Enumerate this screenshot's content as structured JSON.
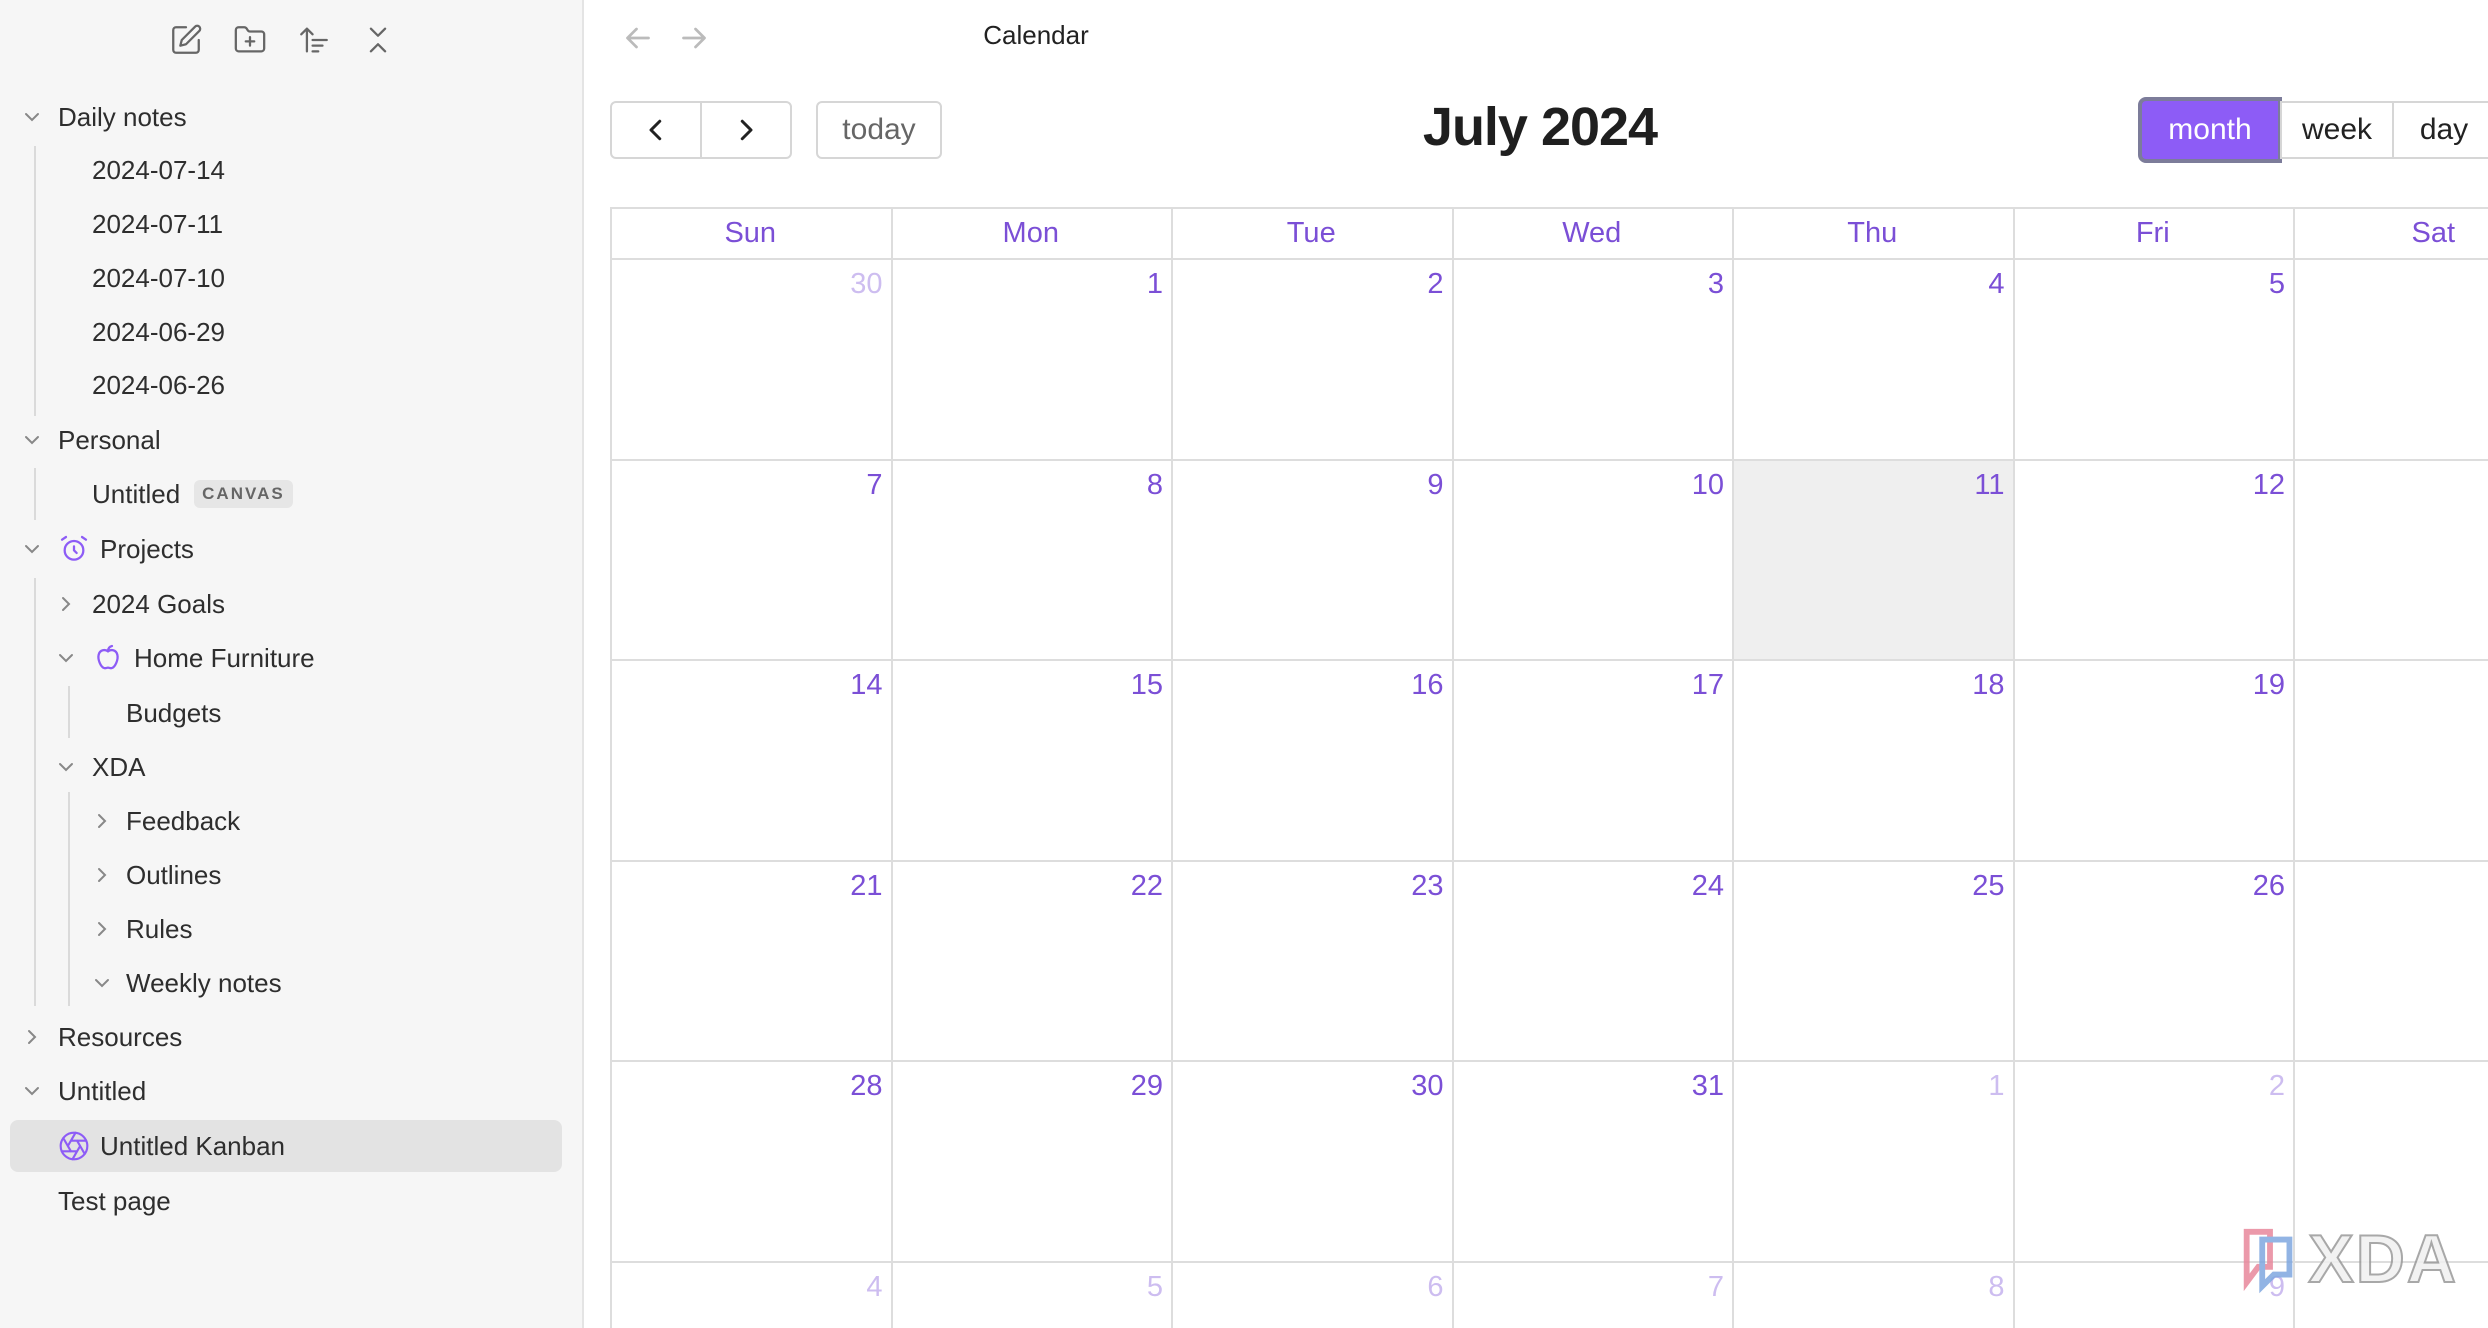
{
  "app": {
    "view_title": "Calendar"
  },
  "sidebar": {
    "items": [
      {
        "label": "Daily notes"
      },
      {
        "label": "2024-07-14"
      },
      {
        "label": "2024-07-11"
      },
      {
        "label": "2024-07-10"
      },
      {
        "label": "2024-06-29"
      },
      {
        "label": "2024-06-26"
      },
      {
        "label": "Personal"
      },
      {
        "label": "Untitled",
        "badge": "CANVAS"
      },
      {
        "label": "Projects",
        "icon": "alarm-clock-icon"
      },
      {
        "label": "2024 Goals"
      },
      {
        "label": "Home Furniture",
        "icon": "apple-icon"
      },
      {
        "label": "Budgets"
      },
      {
        "label": "XDA"
      },
      {
        "label": "Feedback"
      },
      {
        "label": "Outlines"
      },
      {
        "label": "Rules"
      },
      {
        "label": "Weekly notes"
      },
      {
        "label": "Resources"
      },
      {
        "label": "Untitled"
      },
      {
        "label": "Untitled Kanban",
        "icon": "aperture-icon",
        "selected": true
      },
      {
        "label": "Test page"
      }
    ]
  },
  "calendar": {
    "title": "July 2024",
    "today_button": "today",
    "views": [
      "month",
      "week",
      "day"
    ],
    "active_view": "month",
    "weekdays": [
      "Sun",
      "Mon",
      "Tue",
      "Wed",
      "Thu",
      "Fri",
      "Sat"
    ],
    "weeks": [
      [
        "30",
        "1",
        "2",
        "3",
        "4",
        "5",
        ""
      ],
      [
        "7",
        "8",
        "9",
        "10",
        "11",
        "12",
        ""
      ],
      [
        "14",
        "15",
        "16",
        "17",
        "18",
        "19",
        ""
      ],
      [
        "21",
        "22",
        "23",
        "24",
        "25",
        "26",
        ""
      ],
      [
        "28",
        "29",
        "30",
        "31",
        "1",
        "2",
        ""
      ],
      [
        "4",
        "5",
        "6",
        "7",
        "8",
        "9",
        ""
      ]
    ],
    "today": "11",
    "accent_color": "#8d5cf6"
  },
  "watermark": {
    "text": "XDA"
  }
}
